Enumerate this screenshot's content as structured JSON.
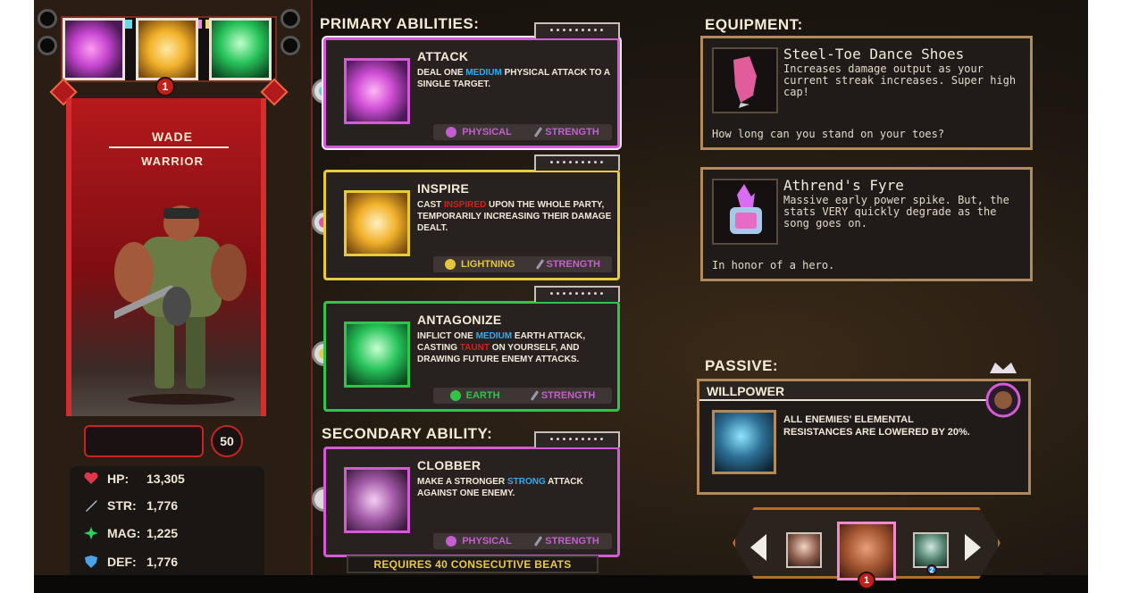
{
  "character": {
    "name": "WADE",
    "class": "WARRIOR",
    "selected_count": "1",
    "energy_value": "50",
    "stats": [
      {
        "icon": "heart-icon",
        "label": "HP:",
        "value": "13,305"
      },
      {
        "icon": "sword-icon",
        "label": "STR:",
        "value": "1,776"
      },
      {
        "icon": "star-burst-icon",
        "label": "MAG:",
        "value": "1,225"
      },
      {
        "icon": "shield-icon",
        "label": "DEF:",
        "value": "1,776"
      }
    ]
  },
  "primary": {
    "title": "PRIMARY ABILITIES:",
    "abilities": [
      {
        "name": "ATTACK",
        "desc_parts": [
          "DEAL ONE ",
          "MEDIUM",
          " PHYSICAL ATTACK TO A SINGLE TARGET."
        ],
        "element": "PHYSICAL",
        "stat": "STRENGTH",
        "tab": "•••••••••"
      },
      {
        "name": "INSPIRE",
        "desc_parts": [
          "CAST ",
          "INSPIRED",
          " UPON THE WHOLE PARTY, TEMPORARILY INCREASING THEIR DAMAGE DEALT."
        ],
        "element": "LIGHTNING",
        "stat": "STRENGTH",
        "tab": "•••••••••"
      },
      {
        "name": "ANTAGONIZE",
        "desc_parts": [
          "INFLICT ONE ",
          "MEDIUM",
          " EARTH ATTACK, CASTING ",
          "TAUNT",
          " ON YOURSELF, AND DRAWING FUTURE ENEMY ATTACKS."
        ],
        "element": "EARTH",
        "stat": "STRENGTH",
        "tab": "•••••••••"
      }
    ]
  },
  "secondary": {
    "title": "SECONDARY ABILITY:",
    "ability": {
      "name": "CLOBBER",
      "desc_parts": [
        "MAKE A STRONGER ",
        "STRONG",
        " ATTACK AGAINST ONE ENEMY."
      ],
      "element": "PHYSICAL",
      "stat": "STRENGTH",
      "tab": "•••••••••"
    },
    "requirement": "REQUIRES 40 CONSECUTIVE BEATS"
  },
  "equipment": {
    "title": "EQUIPMENT:",
    "items": [
      {
        "name": "Steel-Toe Dance Shoes",
        "desc": "Increases damage output as your current streak increases. Super high cap!",
        "flavor": "How long can you stand on your toes?",
        "icon": "dance-shoe-icon"
      },
      {
        "name": "Athrend's Fyre",
        "desc": "Massive early power spike. But, the stats VERY quickly degrade as the song goes on.",
        "flavor": "In honor of a hero.",
        "icon": "flaming-gauntlet-icon"
      }
    ]
  },
  "passive": {
    "title": "PASSIVE:",
    "name": "WILLPOWER",
    "desc": "ALL ENEMIES' ELEMENTAL RESISTANCES ARE LOWERED BY 20%."
  },
  "party": {
    "active_badge": "1",
    "right_badge": "2"
  },
  "colors": {
    "attack_border": "#d55bd6",
    "inspire_border": "#e6cb3c",
    "antagonize_border": "#33c34a",
    "clobber_border": "#d55bd6",
    "element_text": "#c35fcf",
    "lightning_text": "#e6c73c",
    "earth_text": "#33c34a"
  }
}
